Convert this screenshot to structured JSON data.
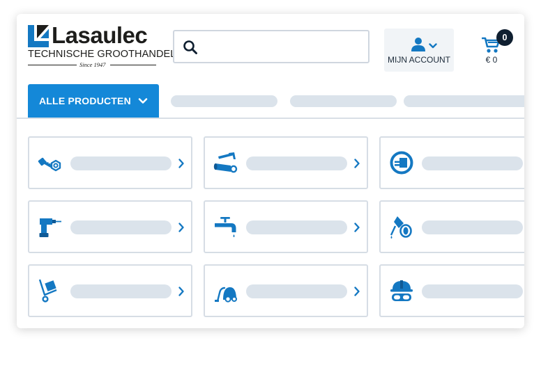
{
  "header": {
    "logo": {
      "name": "Lasaulec",
      "tagline": "TECHNISCHE GROOTHANDEL",
      "since": "Since 1947"
    },
    "search": {
      "value": "",
      "placeholder": "",
      "icon": "search-icon"
    },
    "account": {
      "label": "MIJN ACCOUNT",
      "icon": "user-icon"
    },
    "cart": {
      "count": "0",
      "total": "€ 0",
      "icon": "cart-icon"
    }
  },
  "nav": {
    "main_label": "ALLE PRODUCTEN",
    "other_items_loading": 3
  },
  "categories": [
    {
      "icon": "bolt-nut-icon",
      "label": ""
    },
    {
      "icon": "pipe-ruler-icon",
      "label": ""
    },
    {
      "icon": "power-plug-icon",
      "label": ""
    },
    {
      "icon": "drill-icon",
      "label": ""
    },
    {
      "icon": "water-tap-icon",
      "label": ""
    },
    {
      "icon": "oil-can-icon",
      "label": ""
    },
    {
      "icon": "hand-truck-icon",
      "label": ""
    },
    {
      "icon": "vacuum-cleaner-icon",
      "label": ""
    },
    {
      "icon": "safety-helmet-goggles-icon",
      "label": ""
    }
  ],
  "colors": {
    "brand_blue": "#1488d8",
    "icon_blue": "#1478c2",
    "dark_navy": "#0f1f30",
    "skeleton": "#dbe3eb",
    "border": "#d6dde5"
  }
}
